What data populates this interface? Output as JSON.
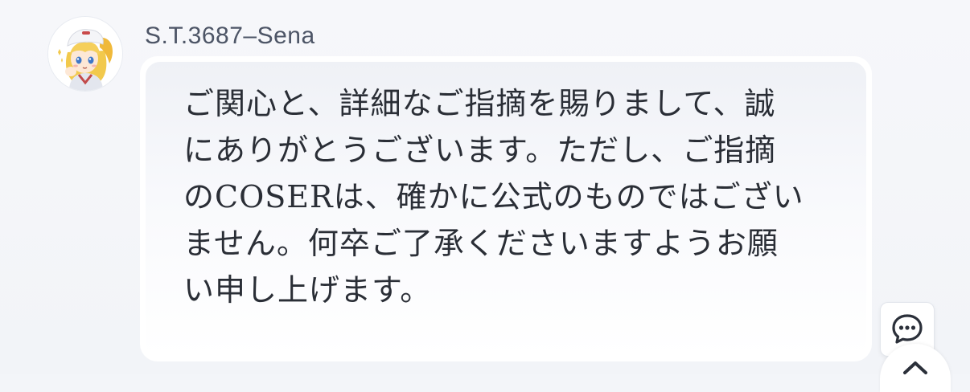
{
  "message": {
    "sender_name": "S.T.3687–Sena",
    "lines": [
      "ご関心と、詳細なご指摘を賜りまして、誠",
      "にありがとうございます。ただし、ご指摘",
      "のCOSERは、確かに公式のものではござい",
      "ません。何卒ご了承くださいますようお願",
      "い申し上げます。"
    ]
  },
  "icons": {
    "avatar": "anime-girl-avatar",
    "chat": "chat-bubble-icon",
    "scroll_top": "chevron-up-icon"
  },
  "colors": {
    "name_text": "#4d5566",
    "message_text": "#2a2e36",
    "bubble_top": "#eff1f6",
    "bubble_bottom": "#ffffff",
    "page_background": "#f3f5f9"
  }
}
